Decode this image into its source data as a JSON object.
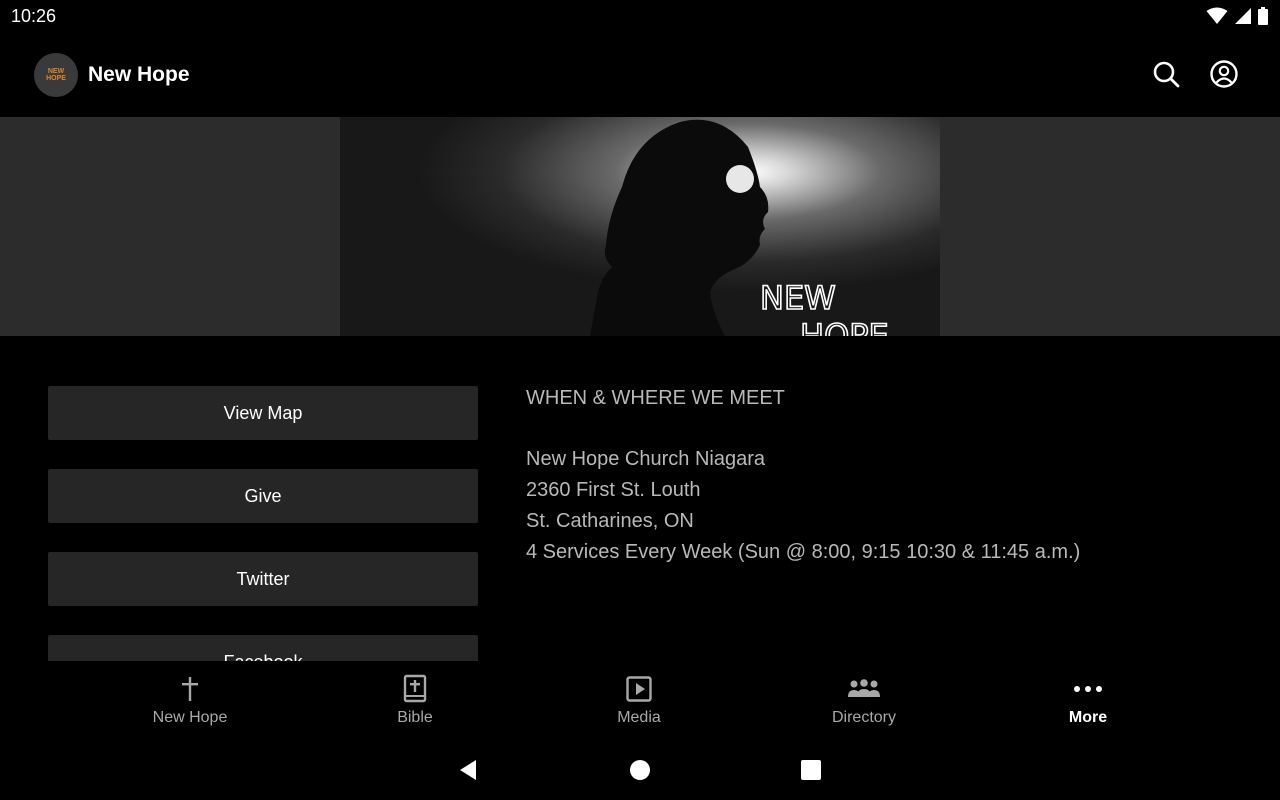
{
  "status_bar": {
    "time": "10:26",
    "icons": [
      "wifi-icon",
      "signal-icon",
      "battery-icon"
    ]
  },
  "app_bar": {
    "logo_text_line1": "NEW",
    "logo_text_line2": "HOPE",
    "title": "New Hope",
    "actions": [
      "search-icon",
      "account-icon"
    ]
  },
  "hero": {
    "image_text_line1": "NEW",
    "image_text_line2": "HOPE"
  },
  "buttons": [
    {
      "label": "View Map"
    },
    {
      "label": "Give"
    },
    {
      "label": "Twitter"
    },
    {
      "label": "Facebook"
    }
  ],
  "info": {
    "heading": "WHEN & WHERE WE MEET",
    "lines": [
      "New Hope Church Niagara",
      "2360 First St. Louth",
      "St. Catharines, ON",
      "4 Services Every Week (Sun @ 8:00, 9:15 10:30 & 11:45 a.m.)"
    ]
  },
  "bottom_nav": {
    "items": [
      {
        "label": "New Hope",
        "icon": "cross-icon"
      },
      {
        "label": "Bible",
        "icon": "bible-icon"
      },
      {
        "label": "Media",
        "icon": "play-icon"
      },
      {
        "label": "Directory",
        "icon": "people-icon"
      },
      {
        "label": "More",
        "icon": "more-icon",
        "active": true
      }
    ]
  },
  "system_nav": [
    "back-icon",
    "home-icon",
    "recents-icon"
  ],
  "colors": {
    "background": "#000000",
    "button_bg": "#262626",
    "hero_bg": "#2c2c2c",
    "info_text": "#b8b8b8",
    "nav_inactive": "#a8a8a8",
    "logo_accent": "#e0862d"
  }
}
